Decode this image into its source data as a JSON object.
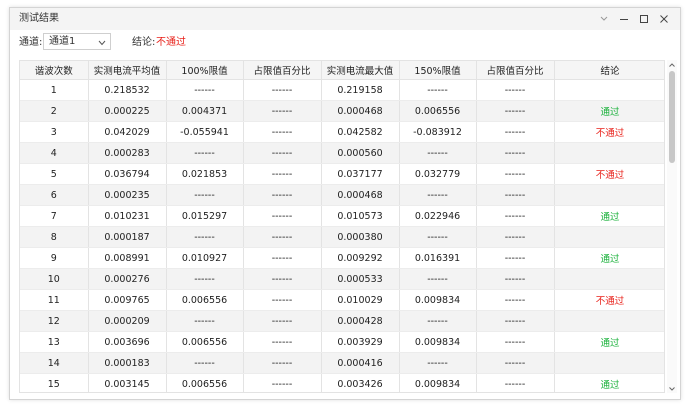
{
  "window": {
    "title": "测试结果"
  },
  "toolbar": {
    "channel_label": "通道:",
    "channel_value": "通道1",
    "verdict_label": "结论:",
    "verdict_value": "不通过",
    "verdict_color": "#e8211a"
  },
  "colors": {
    "pass": "#19b13a",
    "fail": "#e8211a"
  },
  "table": {
    "columns": [
      "谐波次数",
      "实测电流平均值",
      "100%限值",
      "占限值百分比",
      "实测电流最大值",
      "150%限值",
      "占限值百分比",
      "结论"
    ],
    "rows": [
      [
        "1",
        "0.218532",
        "------",
        "------",
        "0.219158",
        "------",
        "------",
        ""
      ],
      [
        "2",
        "0.000225",
        "0.004371",
        "------",
        "0.000468",
        "0.006556",
        "------",
        "通过"
      ],
      [
        "3",
        "0.042029",
        "-0.055941",
        "------",
        "0.042582",
        "-0.083912",
        "------",
        "不通过"
      ],
      [
        "4",
        "0.000283",
        "------",
        "------",
        "0.000560",
        "------",
        "------",
        ""
      ],
      [
        "5",
        "0.036794",
        "0.021853",
        "------",
        "0.037177",
        "0.032779",
        "------",
        "不通过"
      ],
      [
        "6",
        "0.000235",
        "------",
        "------",
        "0.000468",
        "------",
        "------",
        ""
      ],
      [
        "7",
        "0.010231",
        "0.015297",
        "------",
        "0.010573",
        "0.022946",
        "------",
        "通过"
      ],
      [
        "8",
        "0.000187",
        "------",
        "------",
        "0.000380",
        "------",
        "------",
        ""
      ],
      [
        "9",
        "0.008991",
        "0.010927",
        "------",
        "0.009292",
        "0.016391",
        "------",
        "通过"
      ],
      [
        "10",
        "0.000276",
        "------",
        "------",
        "0.000533",
        "------",
        "------",
        ""
      ],
      [
        "11",
        "0.009765",
        "0.006556",
        "------",
        "0.010029",
        "0.009834",
        "------",
        "不通过"
      ],
      [
        "12",
        "0.000209",
        "------",
        "------",
        "0.000428",
        "------",
        "------",
        ""
      ],
      [
        "13",
        "0.003696",
        "0.006556",
        "------",
        "0.003929",
        "0.009834",
        "------",
        "通过"
      ],
      [
        "14",
        "0.000183",
        "------",
        "------",
        "0.000416",
        "------",
        "------",
        ""
      ],
      [
        "15",
        "0.003145",
        "0.006556",
        "------",
        "0.003426",
        "0.009834",
        "------",
        "通过"
      ]
    ]
  },
  "icons": {
    "pin": "pin-icon",
    "minimize": "minimize-icon",
    "maximize": "maximize-icon",
    "close": "close-icon",
    "dropdown": "chevron-down-icon"
  }
}
